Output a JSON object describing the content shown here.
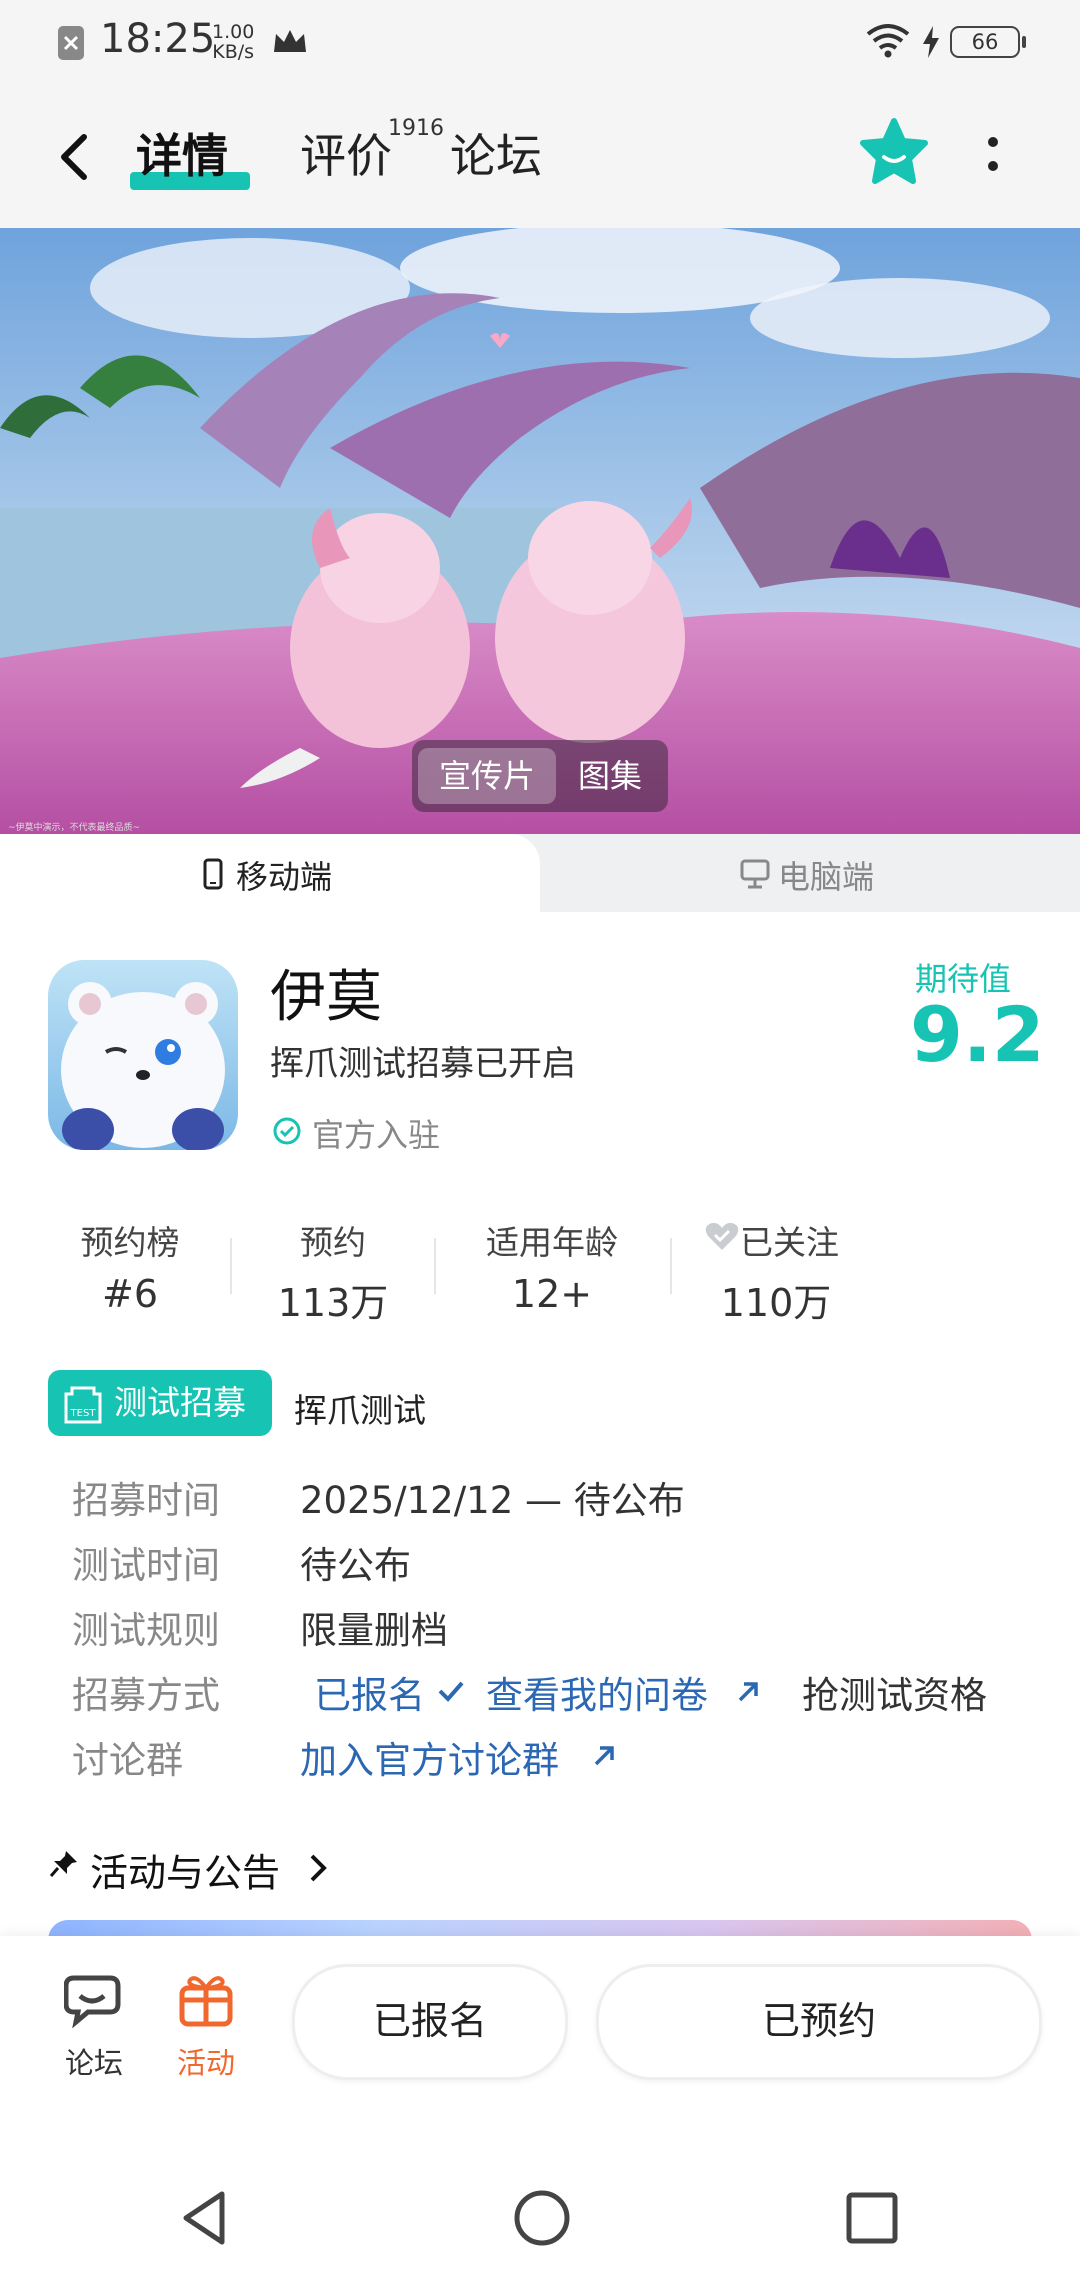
{
  "status_bar": {
    "time": "18:25",
    "net_speed_value": "1.00",
    "net_speed_unit": "KB/s",
    "battery": "66"
  },
  "nav": {
    "tabs": [
      {
        "label": "详情"
      },
      {
        "label": "评价"
      },
      {
        "label": "论坛"
      }
    ],
    "review_count": "1916",
    "accent_color": "#17c3b2"
  },
  "media": {
    "tabs": [
      {
        "label": "宣传片"
      },
      {
        "label": "图集"
      }
    ],
    "disclaimer": "~伊莫中演示，不代表最终品质~"
  },
  "platform_tabs": [
    {
      "label": "移动端"
    },
    {
      "label": "电脑端"
    }
  ],
  "app": {
    "name": "伊莫",
    "subtitle": "挥爪测试招募已开启",
    "official_label": "官方入驻",
    "expectation_label": "期待值",
    "expectation_score": "9.2"
  },
  "stats": [
    {
      "label": "预约榜",
      "value": "#6"
    },
    {
      "label": "预约",
      "value": "113万"
    },
    {
      "label": "适用年龄",
      "value": "12+"
    },
    {
      "label": "已关注",
      "value": "110万"
    }
  ],
  "test": {
    "badge_label": "测试招募",
    "badge_icon_text": "TEST",
    "name": "挥爪测试",
    "rows": {
      "recruit_time_label": "招募时间",
      "recruit_time_value": "2025/12/12 — 待公布",
      "test_time_label": "测试时间",
      "test_time_value": "待公布",
      "test_rule_label": "测试规则",
      "test_rule_value": "限量删档",
      "recruit_method_label": "招募方式",
      "registered_link": "已报名",
      "questionnaire_link": "查看我的问卷",
      "grab_label": "抢测试资格",
      "group_label": "讨论群",
      "group_link": "加入官方讨论群"
    }
  },
  "activity_section": {
    "title": "活动与公告"
  },
  "bottom_bar": {
    "forum_label": "论坛",
    "activity_label": "活动",
    "registered_button": "已报名",
    "reserved_button": "已预约",
    "activity_color": "#f0682e"
  }
}
